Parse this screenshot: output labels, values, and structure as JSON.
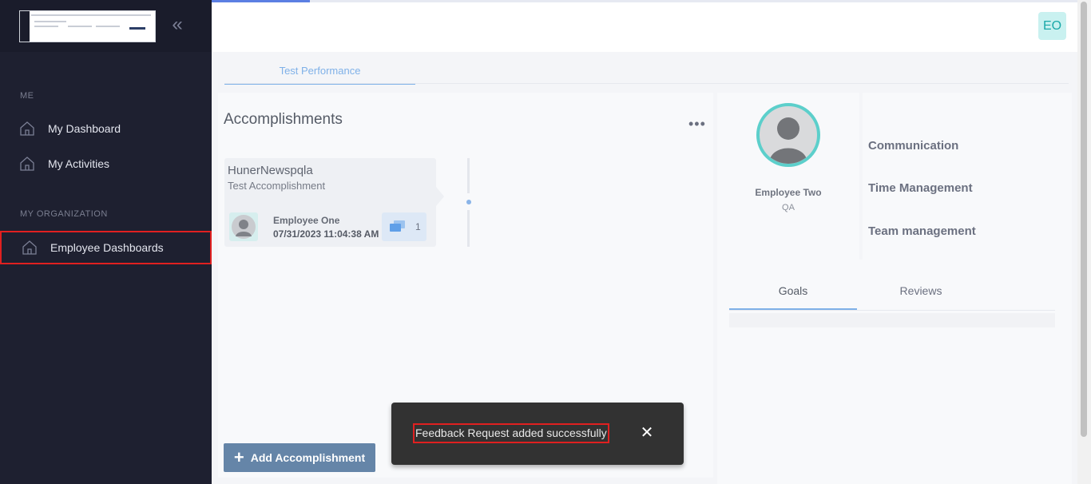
{
  "sidebar": {
    "sections": [
      {
        "label": "ME",
        "items": [
          {
            "label": "My Dashboard",
            "icon": "home-icon"
          },
          {
            "label": "My Activities",
            "icon": "home-icon"
          }
        ]
      },
      {
        "label": "MY ORGANIZATION",
        "items": [
          {
            "label": "Employee Dashboards",
            "icon": "home-icon",
            "active": true
          }
        ]
      }
    ],
    "collapse_icon": "double-chevron-left-icon"
  },
  "header": {
    "user_initials": "EO",
    "progress_percent": 11
  },
  "content": {
    "tab_label": "Test Performance"
  },
  "accomplishments": {
    "title": "Accomplishments",
    "items": [
      {
        "name": "HunerNewspqla",
        "description": "Test Accomplishment",
        "employee": "Employee One",
        "date": "07/31/2023 11:04:38 AM",
        "comment_count": "1"
      }
    ],
    "add_button_label": "Add Accomplishment"
  },
  "profile": {
    "name": "Employee Two",
    "role": "QA"
  },
  "skills": [
    "Communication",
    "Time Management",
    "Team management"
  ],
  "lower_tabs": [
    {
      "label": "Goals",
      "active": true
    },
    {
      "label": "Reviews",
      "active": false
    }
  ],
  "toast": {
    "message": "Feedback Request added successfully"
  },
  "colors": {
    "sidebar_bg": "#1e2030",
    "accent_teal": "#5ccfcb",
    "tab_blue": "#7fb1e8",
    "button_blue": "#6585a8",
    "highlight_red": "#e02020"
  }
}
